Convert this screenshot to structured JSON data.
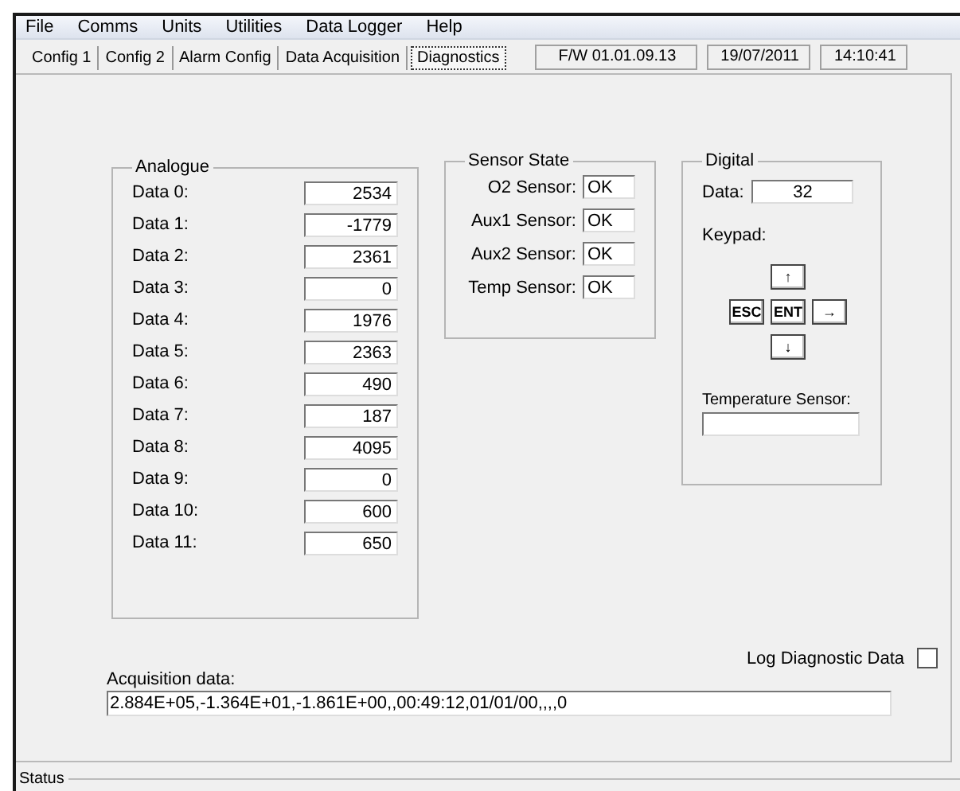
{
  "menu": [
    "File",
    "Comms",
    "Units",
    "Utilities",
    "Data Logger",
    "Help"
  ],
  "tabs": [
    {
      "label": "Config 1",
      "selected": false
    },
    {
      "label": "Config 2",
      "selected": false
    },
    {
      "label": "Alarm Config",
      "selected": false
    },
    {
      "label": "Data Acquisition",
      "selected": false
    },
    {
      "label": "Diagnostics",
      "selected": true
    }
  ],
  "info": [
    "F/W 01.01.09.13",
    "19/07/2011",
    "14:10:41"
  ],
  "analogue": {
    "title": "Analogue",
    "rows": [
      {
        "label": "Data 0:",
        "value": "2534"
      },
      {
        "label": "Data 1:",
        "value": "-1779"
      },
      {
        "label": "Data 2:",
        "value": "2361"
      },
      {
        "label": "Data 3:",
        "value": "0"
      },
      {
        "label": "Data 4:",
        "value": "1976"
      },
      {
        "label": "Data 5:",
        "value": "2363"
      },
      {
        "label": "Data 6:",
        "value": "490"
      },
      {
        "label": "Data 7:",
        "value": "187"
      },
      {
        "label": "Data 8:",
        "value": "4095"
      },
      {
        "label": "Data 9:",
        "value": "0"
      },
      {
        "label": "Data 10:",
        "value": "600"
      },
      {
        "label": "Data 11:",
        "value": "650"
      }
    ]
  },
  "sensor_state": {
    "title": "Sensor State",
    "rows": [
      {
        "label": "O2 Sensor:",
        "value": "OK"
      },
      {
        "label": "Aux1 Sensor:",
        "value": "OK"
      },
      {
        "label": "Aux2 Sensor:",
        "value": "OK"
      },
      {
        "label": "Temp Sensor:",
        "value": "OK"
      }
    ]
  },
  "digital": {
    "title": "Digital",
    "data_label": "Data:",
    "data_value": "32",
    "keypad_label": "Keypad:",
    "keys": {
      "up": "↑",
      "esc": "ESC",
      "ent": "ENT",
      "right": "→",
      "down": "↓"
    },
    "temperature_label": "Temperature Sensor:"
  },
  "log_diagnostic": {
    "label": "Log Diagnostic Data",
    "checked": false
  },
  "acquisition": {
    "label": "Acquisition data:",
    "value": "2.884E+05,-1.364E+01,-1.861E+00,,00:49:12,01/01/00,,,,0"
  },
  "status": {
    "title": "Status"
  }
}
